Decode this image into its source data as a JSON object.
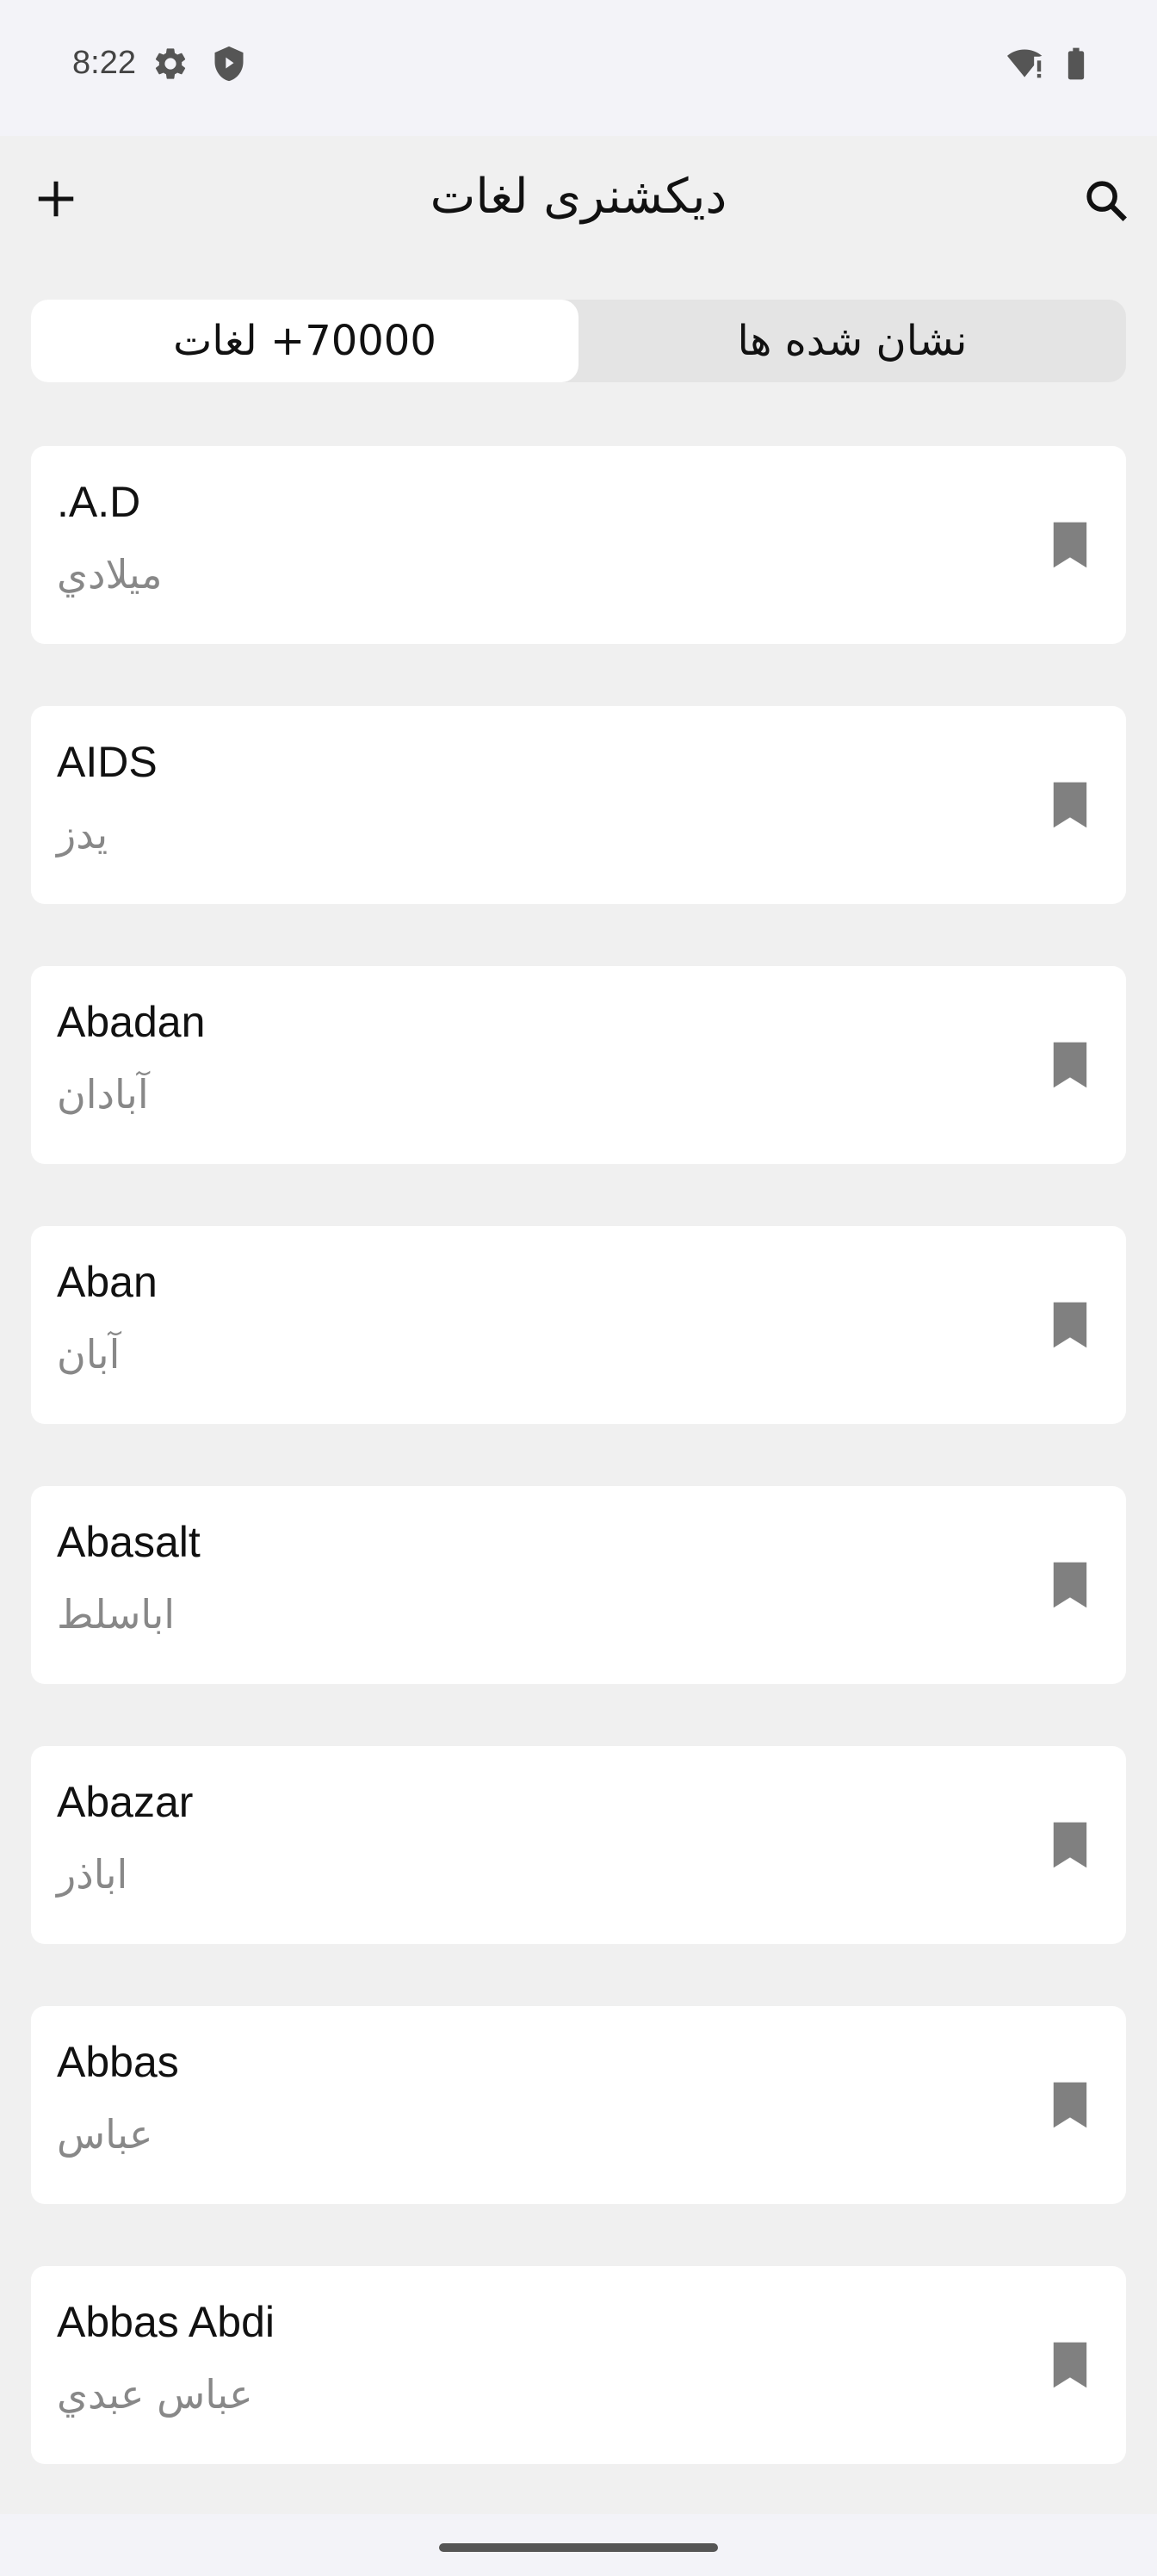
{
  "status_bar": {
    "time": "8:22",
    "icons": [
      "settings-gear-icon",
      "shield-play-icon",
      "wifi-alert-icon",
      "battery-icon"
    ]
  },
  "app_bar": {
    "title": "دیکشنری لغات",
    "add_icon": "plus-icon",
    "search_icon": "search-icon"
  },
  "tabs": {
    "words_label": "70000+ لغات",
    "bookmarks_label": "نشان شده ها",
    "selected": "words"
  },
  "words": [
    {
      "en": ".A.D",
      "fa": "ميلادي"
    },
    {
      "en": "AIDS",
      "fa": "يدز"
    },
    {
      "en": "Abadan",
      "fa": "آبادان"
    },
    {
      "en": "Aban",
      "fa": "آبان"
    },
    {
      "en": "Abasalt",
      "fa": "اباسلط"
    },
    {
      "en": "Abazar",
      "fa": "اباذر"
    },
    {
      "en": "Abbas",
      "fa": "عباس"
    },
    {
      "en": "Abbas Abdi",
      "fa": "عباس عبدي"
    }
  ],
  "colors": {
    "background": "#f0f0f0",
    "card": "#ffffff",
    "selected_tab": "#ffffff",
    "unselected_tab": "#e4e4e4",
    "secondary_text": "#888888",
    "bookmark_icon": "#808080"
  }
}
